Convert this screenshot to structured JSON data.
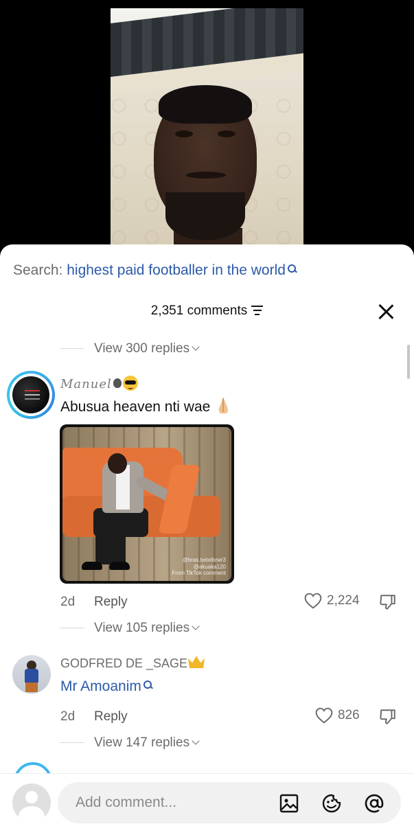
{
  "search": {
    "label": "Search:",
    "term": "highest paid footballer in the world"
  },
  "header": {
    "comment_count": "2,351 comments"
  },
  "threads": {
    "top_view_replies": "View 300 replies",
    "comment1": {
      "username": "Manuel",
      "text": "Abusua heaven nti wae",
      "gif_watermark": [
        "@bras.betelbrwr3",
        "@akuaka120",
        "From TikTok comment"
      ],
      "time": "2d",
      "reply": "Reply",
      "likes": "2,224",
      "view_replies": "View 105 replies"
    },
    "comment2": {
      "username": "GODFRED DE _SAGE",
      "text": "Mr Amoanim",
      "time": "2d",
      "reply": "Reply",
      "likes": "826",
      "view_replies": "View 147 replies"
    }
  },
  "composer": {
    "placeholder": "Add comment..."
  },
  "icons": [
    "search-icon",
    "filter-icon",
    "close-icon",
    "chevron-down-icon",
    "apple-icon",
    "sunglasses-emoji-icon",
    "praying-hands-icon",
    "heart-icon",
    "dislike-icon",
    "crown-icon",
    "image-icon",
    "sticker-icon",
    "mention-icon"
  ],
  "colors": {
    "link_blue": "#2c5aa8",
    "muted_gray": "#6b6b6b",
    "avatar_ring": "#3fb6f0"
  }
}
